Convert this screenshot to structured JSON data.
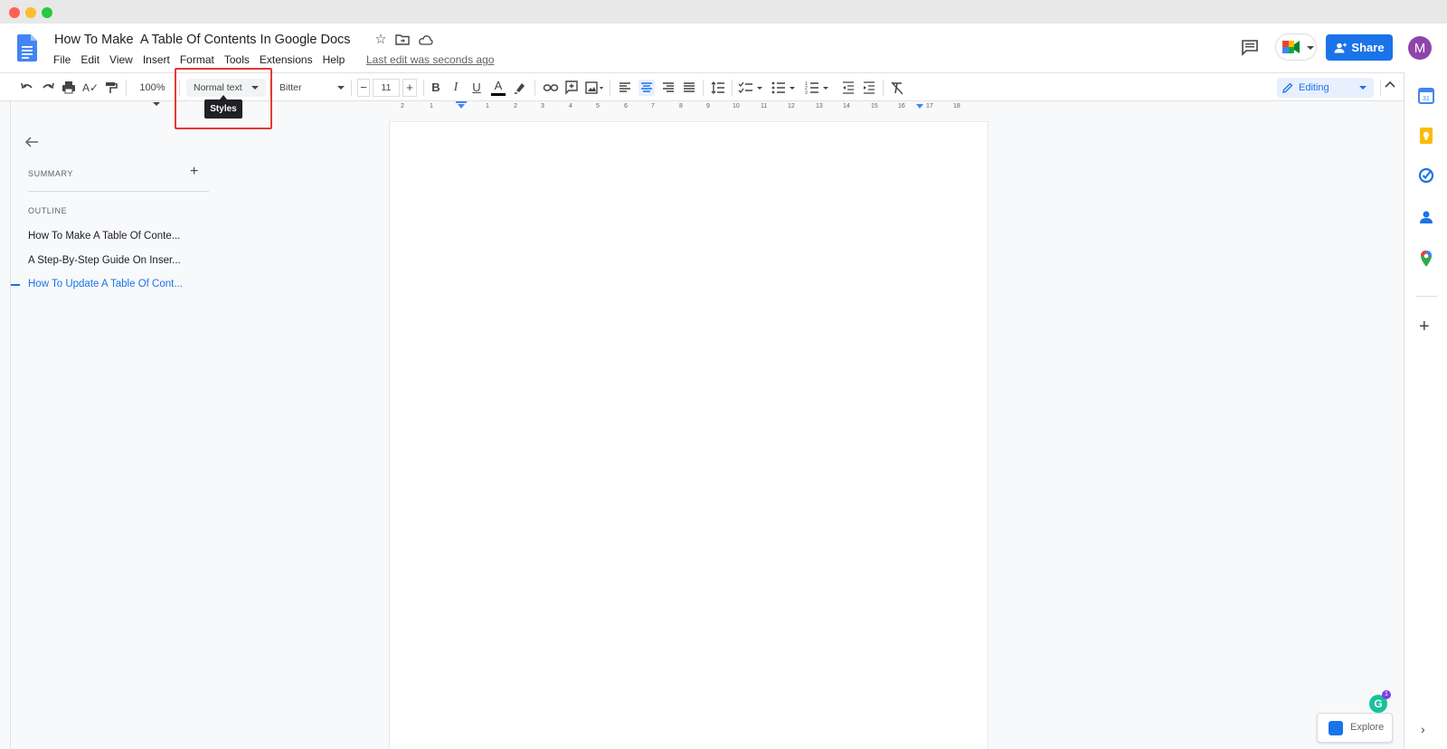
{
  "doc": {
    "title": "How To Make  A Table Of Contents In Google Docs",
    "last_edit": "Last edit was seconds ago"
  },
  "menu": [
    "File",
    "Edit",
    "View",
    "Insert",
    "Format",
    "Tools",
    "Extensions",
    "Help"
  ],
  "header": {
    "share_label": "Share",
    "avatar_initial": "M"
  },
  "toolbar": {
    "zoom": "100%",
    "style": "Normal text",
    "font": "Bitter",
    "font_size": "11",
    "mode": "Editing",
    "tooltip": "Styles",
    "bold": "B",
    "italic": "I",
    "underline": "U",
    "text_color": "A",
    "minus": "−",
    "plus": "+"
  },
  "ruler_ticks": [
    "2",
    "1",
    "1",
    "2",
    "3",
    "4",
    "5",
    "6",
    "7",
    "8",
    "9",
    "10",
    "11",
    "12",
    "13",
    "14",
    "15",
    "16",
    "17",
    "18"
  ],
  "outline_panel": {
    "summary_label": "SUMMARY",
    "outline_label": "OUTLINE",
    "items": [
      "How To Make A Table Of Conte...",
      "A Step-By-Step Guide On Inser...",
      "How To Update A Table Of Cont..."
    ],
    "active_index": 2
  },
  "explore_label": "Explore",
  "grammarly_count": "1",
  "colors": {
    "accent": "#1a73e8",
    "highlight_box": "#e53935",
    "avatar": "#8e44ad"
  }
}
